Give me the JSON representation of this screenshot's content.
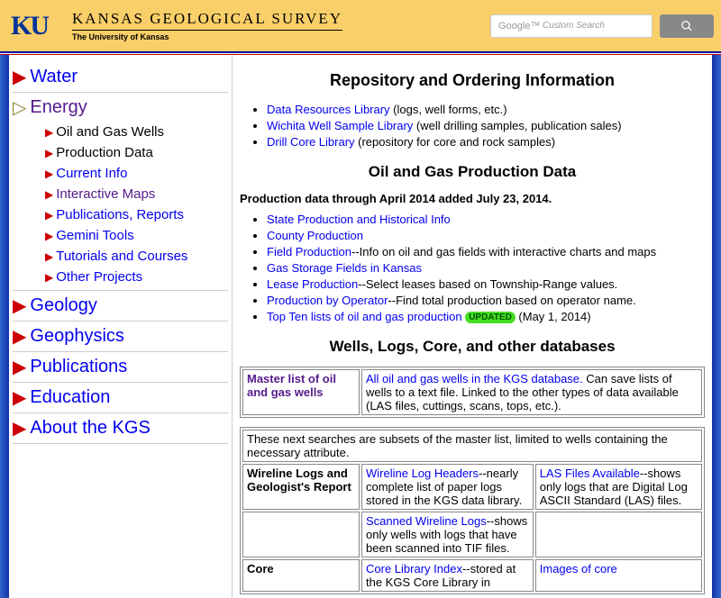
{
  "header": {
    "logo_text": "KU",
    "title_main": "KANSAS GEOLOGICAL SURVEY",
    "title_sub": "The University of Kansas",
    "search_placeholder": "Google™ Custom Search"
  },
  "sidebar": {
    "top": [
      {
        "label": "Water",
        "current": false
      },
      {
        "label": "Energy",
        "current": true
      }
    ],
    "energy_sub": [
      {
        "label": "Oil and Gas Wells",
        "style": "black"
      },
      {
        "label": "Production Data",
        "style": "black"
      },
      {
        "label": "Current Info",
        "style": "link"
      },
      {
        "label": "Interactive Maps",
        "style": "visited"
      },
      {
        "label": "Publications, Reports",
        "style": "link"
      },
      {
        "label": "Gemini Tools",
        "style": "link"
      },
      {
        "label": "Tutorials and Courses",
        "style": "link"
      },
      {
        "label": "Other Projects",
        "style": "link"
      }
    ],
    "rest": [
      {
        "label": "Geology"
      },
      {
        "label": "Geophysics"
      },
      {
        "label": "Publications"
      },
      {
        "label": "Education"
      },
      {
        "label": "About the KGS"
      }
    ]
  },
  "main": {
    "h1": "Repository and Ordering Information",
    "repo_links": [
      {
        "link": "Data Resources Library",
        "after": " (logs, well forms, etc.)"
      },
      {
        "link": "Wichita Well Sample Library",
        "after": " (well drilling samples, publication sales)"
      },
      {
        "link": "Drill Core Library",
        "after": " (repository for core and rock samples)"
      }
    ],
    "h2": "Oil and Gas Production Data",
    "bold_note": "Production data through April 2014 added July 23, 2014.",
    "prod_links": [
      {
        "link": "State Production and Historical Info",
        "after": ""
      },
      {
        "link": "County Production",
        "after": ""
      },
      {
        "link": "Field Production",
        "after": "--Info on oil and gas fields with interactive charts and maps"
      },
      {
        "link": "Gas Storage Fields in Kansas",
        "after": ""
      },
      {
        "link": "Lease Production",
        "after": "--Select leases based on Township-Range values."
      },
      {
        "link": "Production by Operator",
        "after": "--Find total production based on operator name."
      },
      {
        "link": "Top Ten lists of oil and gas production",
        "after": " ",
        "tag": "UPDATED",
        "date": " (May 1, 2014)"
      }
    ],
    "h3": "Wells, Logs, Core, and other databases",
    "table1": {
      "rowhead": "Master list of oil and gas wells",
      "link": "All oil and gas wells in the KGS database.",
      "after": " Can save lists of wells to a text file. Linked to the other types of data available (LAS files, cuttings, scans, tops, etc.)."
    },
    "table2": {
      "note": "These next searches are subsets of the master list, limited to wells containing the necessary attribute.",
      "rows": [
        {
          "head": "Wireline Logs and Geologist's Report",
          "c1_link": "Wireline Log Headers",
          "c1_after": "--nearly complete list of paper logs stored in the KGS data library.",
          "c2_link": "LAS Files Available",
          "c2_after": "--shows only logs that are Digital Log ASCII Standard (LAS) files."
        },
        {
          "head": "",
          "c1_link": "Scanned Wireline Logs",
          "c1_after": "--shows only wells with logs that have been scanned into TIF files.",
          "c2_link": "",
          "c2_after": ""
        },
        {
          "head": "Core",
          "c1_link": "Core Library Index",
          "c1_after": "--stored at the KGS Core Library in",
          "c2_link": "Images of core",
          "c2_after": ""
        }
      ]
    }
  }
}
